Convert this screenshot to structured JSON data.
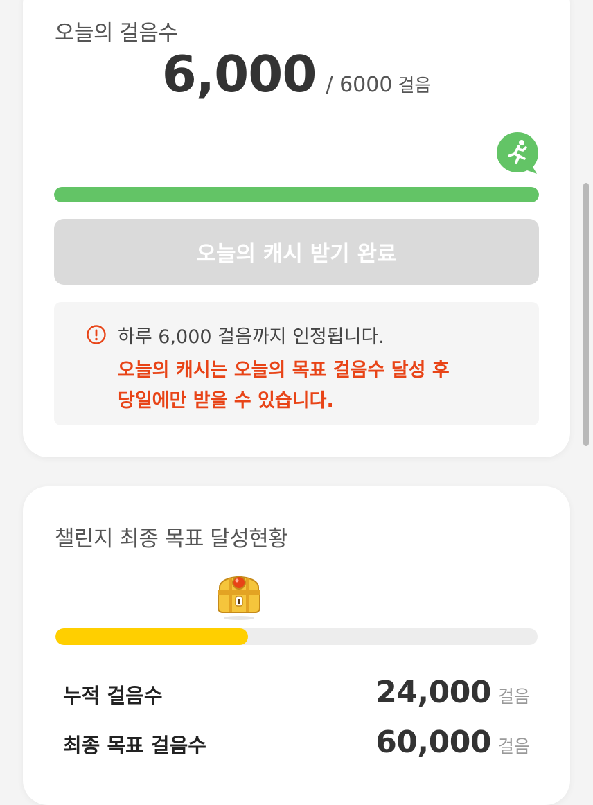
{
  "today": {
    "title": "오늘의 걸음수",
    "steps_current": "6,000",
    "steps_goal": "/ 6000",
    "steps_unit": "걸음",
    "progress_fraction": 1.0,
    "button_label": "오늘의 캐시 받기 완료",
    "notice_line1": "하루 6,000 걸음까지 인정됩니다.",
    "notice_red_line1": "오늘의 캐시는 오늘의 목표 걸음수 달성 후",
    "notice_red_line2": "당일에만 받을 수 있습니다."
  },
  "challenge": {
    "title": "챌린지 최종 목표 달성현황",
    "progress_fraction": 0.4,
    "stats": [
      {
        "label": "누적 걸음수",
        "value": "24,000",
        "unit": "걸음"
      },
      {
        "label": "최종 목표 걸음수",
        "value": "60,000",
        "unit": "걸음"
      }
    ]
  },
  "colors": {
    "accent_green": "#63c466",
    "accent_yellow": "#ffcf00",
    "notice_red": "#e84417",
    "button_disabled": "#dadada"
  },
  "icons": {
    "runner": "running-person-icon",
    "notice": "exclamation-circle-icon",
    "chest": "treasure-chest-icon"
  }
}
